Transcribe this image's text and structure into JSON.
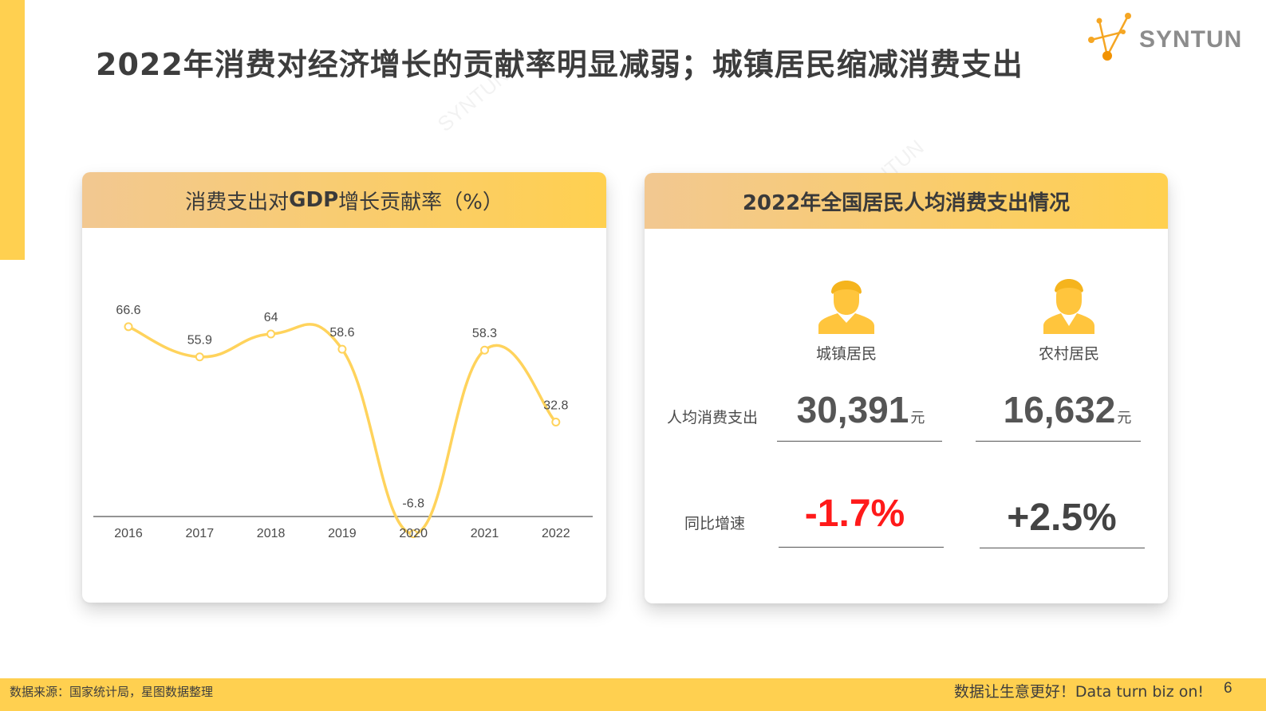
{
  "page": {
    "title": "2022年消费对经济增长的贡献率明显减弱；城镇居民缩减消费支出",
    "number": "6"
  },
  "brand": {
    "logo_text": "SYNTUN",
    "watermark": "SYNTUN",
    "accent_color": "#ffd050",
    "line_color": "#ffd35c",
    "negative_color": "#ff1a1a"
  },
  "left_panel": {
    "title_prefix": "消费支出对",
    "title_mid": "GDP",
    "title_suffix": "增长贡献率（%）"
  },
  "chart_data": {
    "type": "line",
    "categories": [
      "2016",
      "2017",
      "2018",
      "2019",
      "2020",
      "2021",
      "2022"
    ],
    "series": [
      {
        "values": [
          66.6,
          55.9,
          64,
          58.6,
          -6.8,
          58.3,
          32.8
        ]
      }
    ],
    "data_labels": [
      "66.6",
      "55.9",
      "64",
      "58.6",
      "-6.8",
      "58.3",
      "32.8"
    ],
    "smooth": true,
    "grid": false,
    "legend": "none"
  },
  "right_panel": {
    "title": "2022年全国居民人均消费支出情况",
    "columns": [
      {
        "label": "城镇居民",
        "icon": "urban-resident-icon"
      },
      {
        "label": "农村居民",
        "icon": "rural-resident-icon"
      }
    ],
    "rows": {
      "spending_label": "人均消费支出",
      "growth_label": "同比增速"
    },
    "urban": {
      "spending": "30,391",
      "unit": "元",
      "growth": "-1.7%"
    },
    "rural": {
      "spending": "16,632",
      "unit": "元",
      "growth": "+2.5%"
    }
  },
  "footer": {
    "source": "数据来源：国家统计局，星图数据整理",
    "slogan": "数据让生意更好！Data turn biz on!"
  }
}
